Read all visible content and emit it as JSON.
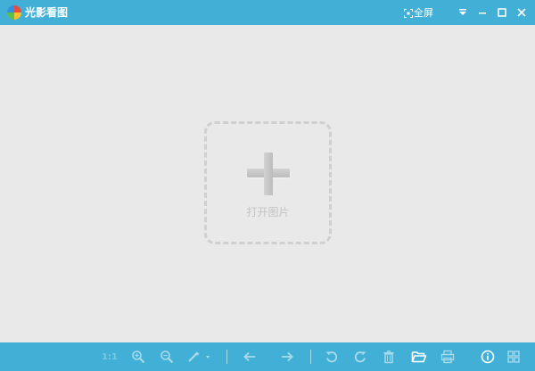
{
  "window": {
    "title": "光影看图",
    "fullscreen_label": "全屏"
  },
  "canvas": {
    "open_label": "打开图片"
  },
  "toolbar": {
    "ratio_label": "1:1"
  },
  "colors": {
    "bar": "#42b0d6",
    "background": "#e9e9e9"
  }
}
